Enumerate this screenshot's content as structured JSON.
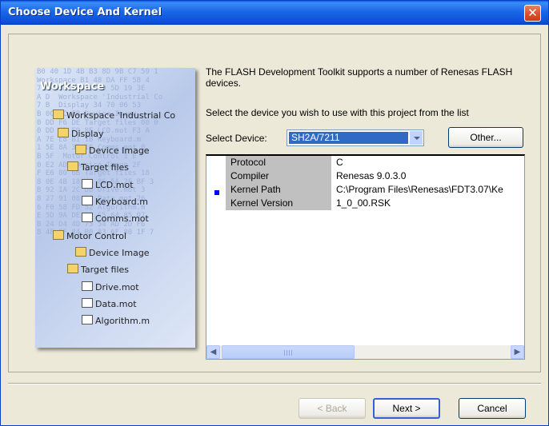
{
  "window": {
    "title": "Choose Device And Kernel",
    "close_glyph": "✕"
  },
  "wizard_image": {
    "hex_background": "B0 40 1D 4B B3 8D 9B C7 59 1\nWorkspace B1 48 DA FF 5B 4\n7 2A 9A 34 CB 4D 5D 19 3E\nA D  Workspace 'Industrial Co\n7 B  Display 34 70 06 53\nB 0C EC-FB Device Image\n0 DD F6 DE Target files 00 0\n0 DD 6D F9 8E LCD.mot F3 A\nA 7E E8 B1 1B Keyboard.m\n1 5E 8A 33 16 Comms.mot 0\nB 5F  Motor Control 1 E\n0 E2 AD  Device Image 2F\nF E6 80 6B Target files 18\n8 0E 4B 18 4A 86 5A 2F BF 3\nB 92 1A 2C D8 Drive.mot 3\n8 27 91 08 1A Data.mot 26\n6 F0 58 FD 52 Algorithm.m\nE 5D 9A DE A9 C5 64 85 97\nB 24 D4 4D 75 54 AD 2D F6\nB 4F EF 84 B0 83 6F 80 1F 7",
    "workspace_title": "Workspace",
    "tree_workspace": "Workspace 'Industrial Co",
    "tree_display": "Display",
    "tree_device_image_1": "Device Image",
    "tree_target_files_1": "Target files",
    "tree_lcd": "LCD.mot",
    "tree_keyboard": "Keyboard.m",
    "tree_comms": "Comms.mot",
    "tree_motor_control": "Motor Control",
    "tree_device_image_2": "Device Image",
    "tree_target_files_2": "Target files",
    "tree_drive": "Drive.mot",
    "tree_data": "Data.mot",
    "tree_algorithm": "Algorithm.m"
  },
  "content": {
    "description": "The FLASH Development Toolkit supports a number of Renesas FLASH devices.",
    "instruction": "Select the device you wish to use with this project from the list",
    "select_label": "Select Device:",
    "select_value": "SH2A/7211",
    "other_button": "Other..."
  },
  "device_info": [
    {
      "key": "Protocol",
      "value": "C"
    },
    {
      "key": "Compiler",
      "value": "Renesas 9.0.3.0"
    },
    {
      "key": "Kernel Path",
      "value": "C:\\Program Files\\Renesas\\FDT3.07\\Ke"
    },
    {
      "key": "Kernel Version",
      "value": "1_0_00.RSK"
    }
  ],
  "scrollbar": {
    "left_arrow": "◀",
    "right_arrow": "▶"
  },
  "buttons": {
    "back": "< Back",
    "next": "Next >",
    "cancel": "Cancel"
  },
  "colors": {
    "titlebar": "#0b4fd7",
    "selection": "#316ac5",
    "dialog_bg": "#ece9d8"
  }
}
